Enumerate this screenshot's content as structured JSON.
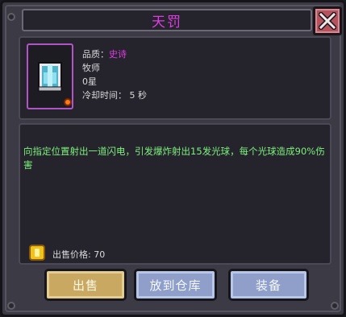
{
  "title": "天罚",
  "item": {
    "quality_label": "品质：",
    "quality_value": "史诗",
    "class": "牧师",
    "stars": "0星",
    "cooldown": "冷却时间： 5 秒"
  },
  "description": "向指定位置射出一道闪电，引发爆炸射出15发光球，每个光球造成90%伤害",
  "price": "出售价格: 70",
  "buttons": {
    "sell": "出售",
    "store": "放到仓库",
    "equip": "装备"
  },
  "colors": {
    "epic": "#e13be6",
    "description": "#7df07d",
    "sell_button": "#c9a862",
    "action_button": "#8f9fc9",
    "close_button": "#b4525e"
  },
  "icons": {
    "close": "close-x-icon",
    "item": "lightning-tome-icon",
    "fire": "fire-element-icon",
    "coin": "gold-coin-icon"
  }
}
